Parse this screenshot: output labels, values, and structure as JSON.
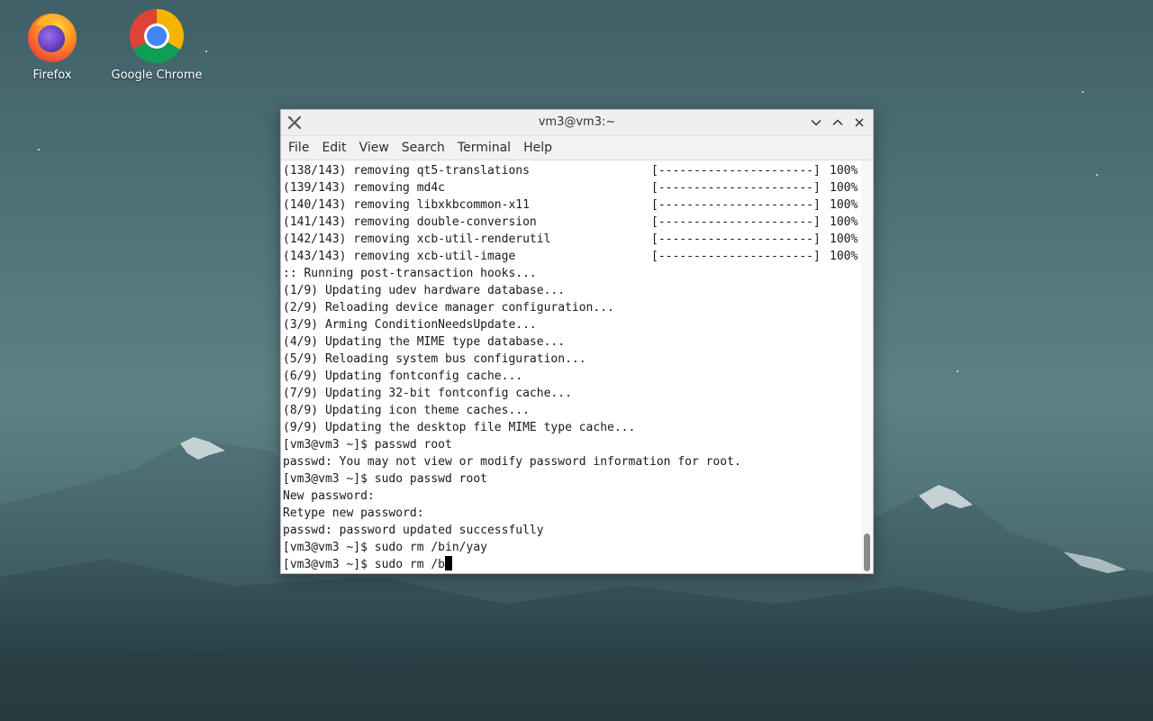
{
  "desktop": {
    "icons": [
      {
        "label": "Firefox"
      },
      {
        "label": "Google Chrome"
      }
    ]
  },
  "window": {
    "title": "vm3@vm3:~",
    "menu": [
      "File",
      "Edit",
      "View",
      "Search",
      "Terminal",
      "Help"
    ]
  },
  "terminal": {
    "progress_lines": [
      {
        "text": "(138/143) removing qt5-translations",
        "bar": "[----------------------]",
        "percent": "100%"
      },
      {
        "text": "(139/143) removing md4c",
        "bar": "[----------------------]",
        "percent": "100%"
      },
      {
        "text": "(140/143) removing libxkbcommon-x11",
        "bar": "[----------------------]",
        "percent": "100%"
      },
      {
        "text": "(141/143) removing double-conversion",
        "bar": "[----------------------]",
        "percent": "100%"
      },
      {
        "text": "(142/143) removing xcb-util-renderutil",
        "bar": "[----------------------]",
        "percent": "100%"
      },
      {
        "text": "(143/143) removing xcb-util-image",
        "bar": "[----------------------]",
        "percent": "100%"
      }
    ],
    "lines": [
      ":: Running post-transaction hooks...",
      "(1/9) Updating udev hardware database...",
      "(2/9) Reloading device manager configuration...",
      "(3/9) Arming ConditionNeedsUpdate...",
      "(4/9) Updating the MIME type database...",
      "(5/9) Reloading system bus configuration...",
      "(6/9) Updating fontconfig cache...",
      "(7/9) Updating 32-bit fontconfig cache...",
      "(8/9) Updating icon theme caches...",
      "(9/9) Updating the desktop file MIME type cache...",
      "[vm3@vm3 ~]$ passwd root",
      "passwd: You may not view or modify password information for root.",
      "[vm3@vm3 ~]$ sudo passwd root",
      "New password:",
      "Retype new password:",
      "passwd: password updated successfully",
      "[vm3@vm3 ~]$ sudo rm /bin/yay"
    ],
    "current_prompt": "[vm3@vm3 ~]$ sudo rm /b"
  },
  "colors": {
    "sky_top": "#3f6066",
    "sky_mid": "#5d8185",
    "mountain_dark": "#2f4a4f",
    "snow": "#d9e3e4",
    "terminal_bg": "#ffffff",
    "terminal_fg": "#1a1a1a"
  },
  "icons": {
    "firefox": "firefox-icon",
    "chrome": "chrome-icon",
    "app": "terminal-app-icon",
    "minimize": "chevron-down-icon",
    "maximize": "chevron-up-icon",
    "close": "close-icon"
  }
}
